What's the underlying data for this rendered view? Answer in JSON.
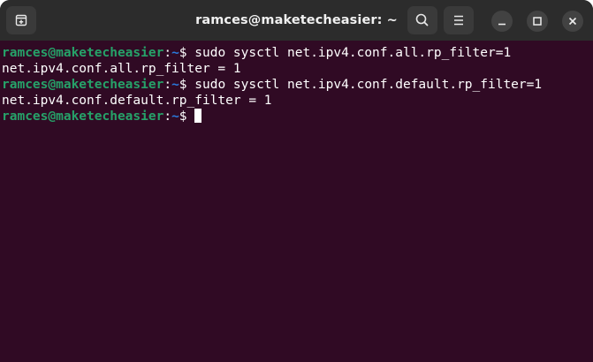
{
  "window": {
    "title": "ramces@maketecheasier: ~"
  },
  "icons": {
    "new_tab": "new-tab-icon",
    "search": "search-icon",
    "menu": "hamburger-menu-icon",
    "minimize": "minimize-icon",
    "maximize": "maximize-icon",
    "close": "close-icon"
  },
  "colors": {
    "terminal_bg": "#300a24",
    "titlebar_bg": "#2c2c2c",
    "prompt_user": "#26a269",
    "prompt_path": "#2a7bde",
    "text": "#ffffff"
  },
  "terminal": {
    "lines": [
      {
        "type": "command",
        "user_host": "ramces@maketecheasier",
        "colon": ":",
        "path": "~",
        "symbol": "$",
        "command": " sudo sysctl net.ipv4.conf.all.rp_filter=1"
      },
      {
        "type": "output",
        "text": "net.ipv4.conf.all.rp_filter = 1"
      },
      {
        "type": "command",
        "user_host": "ramces@maketecheasier",
        "colon": ":",
        "path": "~",
        "symbol": "$",
        "command": " sudo sysctl net.ipv4.conf.default.rp_filter=1"
      },
      {
        "type": "output",
        "text": "net.ipv4.conf.default.rp_filter = 1"
      },
      {
        "type": "command",
        "user_host": "ramces@maketecheasier",
        "colon": ":",
        "path": "~",
        "symbol": "$",
        "command": " "
      }
    ]
  }
}
